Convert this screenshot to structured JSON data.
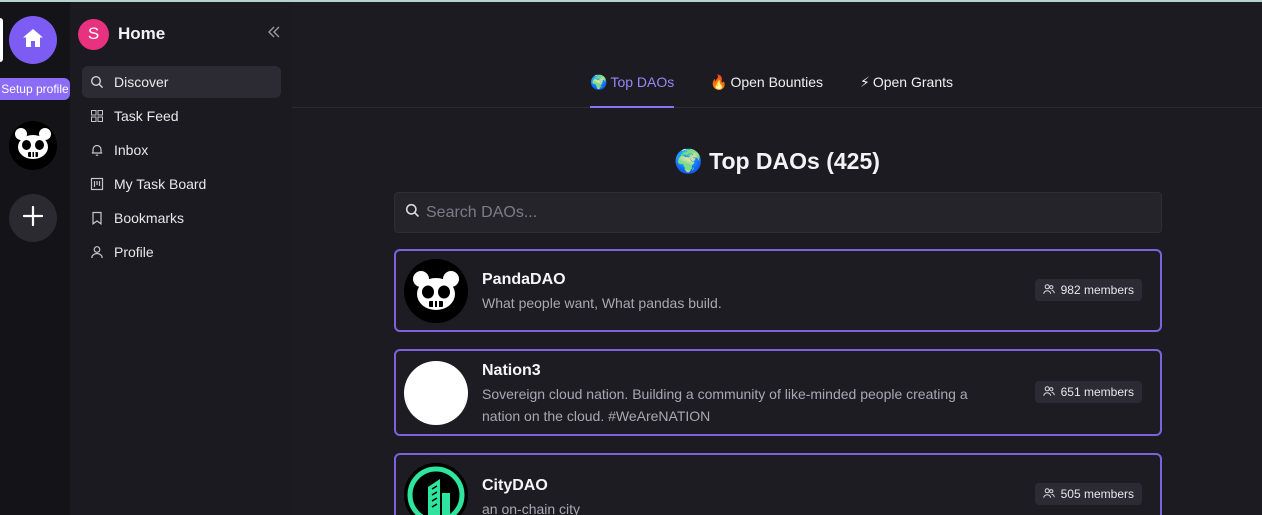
{
  "rail": {
    "setup_label": "Setup profile"
  },
  "sidebar": {
    "avatar_letter": "S",
    "title": "Home",
    "items": [
      {
        "label": "Discover",
        "icon": "search-icon"
      },
      {
        "label": "Task Feed",
        "icon": "grid-icon"
      },
      {
        "label": "Inbox",
        "icon": "bell-icon"
      },
      {
        "label": "My Task Board",
        "icon": "kanban-icon"
      },
      {
        "label": "Bookmarks",
        "icon": "bookmark-icon"
      },
      {
        "label": "Profile",
        "icon": "user-icon"
      }
    ]
  },
  "tabs": [
    {
      "emoji": "🌍",
      "label": "Top DAOs",
      "active": true
    },
    {
      "emoji": "🔥",
      "label": "Open Bounties",
      "active": false
    },
    {
      "emoji": "⚡",
      "label": "Open Grants",
      "active": false
    }
  ],
  "main": {
    "title": "🌍 Top DAOs (425)",
    "search_placeholder": "Search DAOs..."
  },
  "daos": [
    {
      "name": "PandaDAO",
      "description": "What people want, What pandas build.",
      "members": "982 members",
      "logo": "panda-logo"
    },
    {
      "name": "Nation3",
      "description": "Sovereign cloud nation. Building a community of like-minded people creating a nation on the cloud. #WeAreNATION",
      "members": "651 members",
      "logo": "nation3-logo"
    },
    {
      "name": "CityDAO",
      "description": "an on-chain city",
      "members": "505 members",
      "logo": "citydao-logo"
    }
  ],
  "colors": {
    "accent": "#7b63dd",
    "home_button": "#7c5cf2",
    "avatar": "#e8327f"
  }
}
